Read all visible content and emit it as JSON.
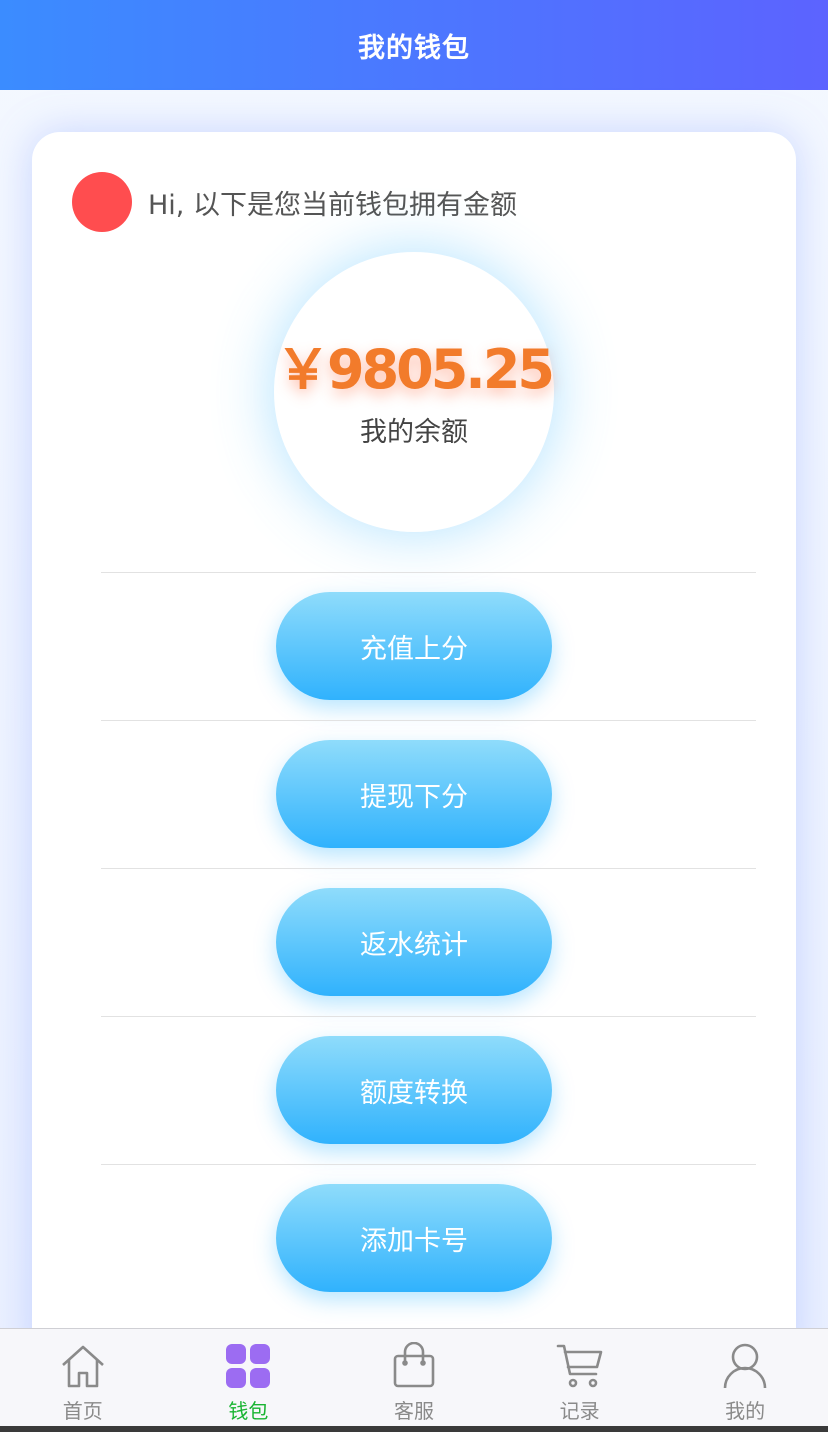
{
  "header": {
    "title": "我的钱包"
  },
  "greeting": {
    "text": "Hi, 以下是您当前钱包拥有金额"
  },
  "balance": {
    "amount": "￥9805.25",
    "label": "我的余额"
  },
  "actions": [
    {
      "label": "充值上分"
    },
    {
      "label": "提现下分"
    },
    {
      "label": "返水统计"
    },
    {
      "label": "额度转换"
    },
    {
      "label": "添加卡号"
    }
  ],
  "tabbar": {
    "items": [
      {
        "label": "首页",
        "icon": "home-icon"
      },
      {
        "label": "钱包",
        "icon": "grid-icon",
        "active": true
      },
      {
        "label": "客服",
        "icon": "bag-icon"
      },
      {
        "label": "记录",
        "icon": "cart-icon"
      },
      {
        "label": "我的",
        "icon": "user-icon"
      }
    ]
  },
  "colors": {
    "header_gradient": [
      "#3b8cff",
      "#5c63ff"
    ],
    "balance": "#f27b2b",
    "button_gradient": [
      "#8fdcfb",
      "#30b2fd"
    ],
    "avatar": "#ff4d4f",
    "tab_active": "#19b432",
    "tab_active_icon": "#9c6cf2"
  }
}
